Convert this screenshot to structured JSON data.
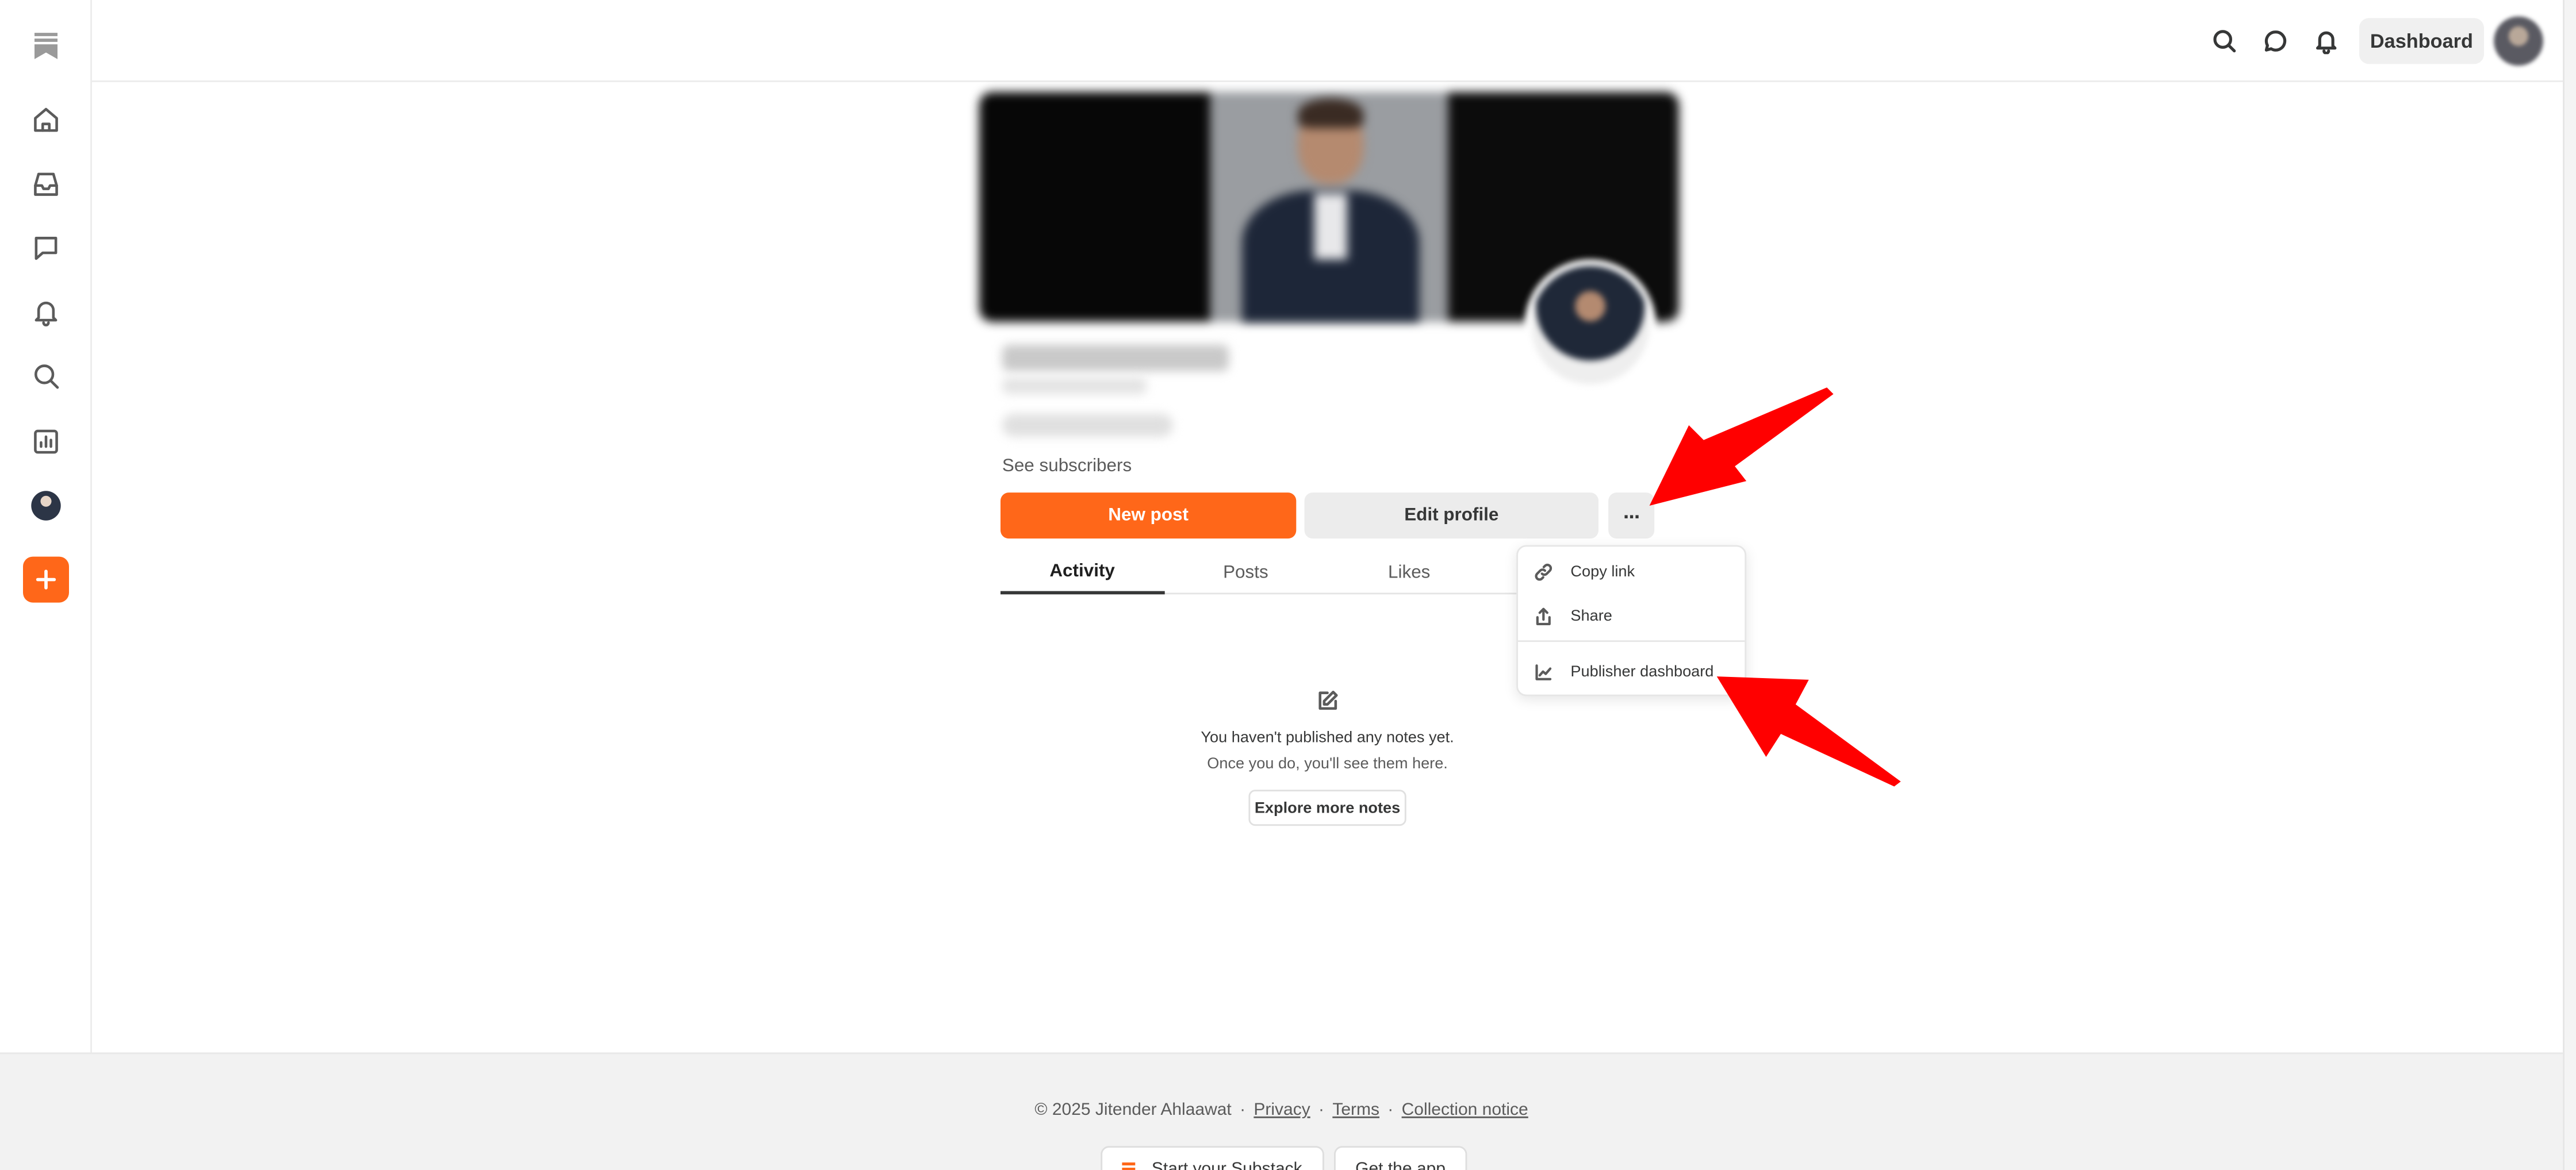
{
  "topbar": {
    "dashboard_label": "Dashboard",
    "icons": [
      "search-icon",
      "chat-icon",
      "bell-icon"
    ]
  },
  "sidebar": {
    "icons": [
      "bookmark-logo-icon",
      "home-icon",
      "inbox-icon",
      "chat-icon",
      "bell-icon",
      "search-icon",
      "stats-icon",
      "profile-avatar",
      "create-plus-icon"
    ]
  },
  "profile": {
    "see_subscribers": "See subscribers",
    "new_post_label": "New post",
    "edit_profile_label": "Edit profile",
    "more_label": "···",
    "tabs": [
      "Activity",
      "Posts",
      "Likes"
    ],
    "active_tab": "Activity"
  },
  "menu": {
    "items": [
      {
        "label": "Copy link",
        "icon": "link-icon"
      },
      {
        "label": "Share",
        "icon": "share-icon"
      },
      {
        "label": "Publisher dashboard",
        "icon": "chart-icon"
      }
    ]
  },
  "empty_state": {
    "title": "You haven't published any notes yet.",
    "subtitle": "Once you do, you'll see them here.",
    "button": "Explore more notes"
  },
  "footer": {
    "copyright": "© 2025 Jitender Ahlaawat",
    "separator": "·",
    "links": [
      "Privacy",
      "Terms",
      "Collection notice"
    ],
    "start_label": "Start your Substack",
    "app_label": "Get the app"
  },
  "colors": {
    "accent": "#ff6719",
    "annotation_arrow": "#ff0000"
  }
}
